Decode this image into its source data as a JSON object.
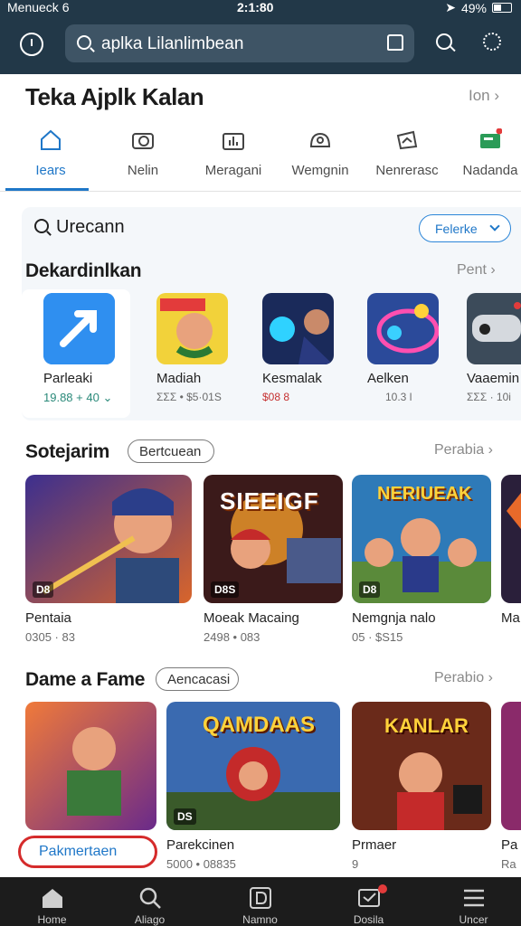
{
  "status_bar": {
    "carrier": "Menueck 6",
    "time": "2:1:80",
    "battery": "49%",
    "battery_level": 0.49
  },
  "header": {
    "search_query": "aplka Lilanlimbean"
  },
  "title_section": {
    "title": "Teka Ajplk Kalan",
    "more": "Ion"
  },
  "tabs": [
    {
      "label": "Iears",
      "icon": "home-icon",
      "active": true
    },
    {
      "label": "Nelin",
      "icon": "camera-icon",
      "active": false
    },
    {
      "label": "Meragani",
      "icon": "chart-icon",
      "active": false
    },
    {
      "label": "Wemgnin",
      "icon": "face-icon",
      "active": false
    },
    {
      "label": "Nenrerasc",
      "icon": "ticket-icon",
      "active": false
    },
    {
      "label": "Nadanda",
      "icon": "wallet-icon",
      "active": false
    }
  ],
  "card": {
    "search_text": "Urecann",
    "pill_label": "Felerke",
    "section_title": "Dekardinlkan",
    "section_more": "Pent"
  },
  "apps": [
    {
      "name": "Parleaki",
      "meta": "19.88 + 40"
    },
    {
      "name": "Madiah",
      "meta": "ΣΣΣ • $5·01S"
    },
    {
      "name": "Kesmalak",
      "meta": "$08 8"
    },
    {
      "name": "Aelken",
      "meta": "10.3 l"
    },
    {
      "name": "Vaaemin",
      "meta": "ΣΣΣ · 10i"
    }
  ],
  "section2": {
    "title": "Sotejarim",
    "pill": "Bertcuean",
    "more": "Perabia",
    "games": [
      {
        "name": "Pentaia",
        "meta": "0305 · 83",
        "badge": "D8"
      },
      {
        "name": "Moeak Macaing",
        "meta": "2498 • 083",
        "badge": "D8S",
        "art_text": "SIEEIGF"
      },
      {
        "name": "Nemgnja nalo",
        "meta": "05 · $S15",
        "badge": "D8",
        "art_text": "NERIUEAK"
      },
      {
        "name": "Ma",
        "meta": "",
        "badge": ""
      }
    ]
  },
  "section3": {
    "title": "Dame a Fame",
    "pill": "Aencacasi",
    "more": "Perabio",
    "games": [
      {
        "name": "",
        "meta": "",
        "badge": ""
      },
      {
        "name": "Parekcinen",
        "meta": "5000 • 08835",
        "badge": "DS",
        "art_text": "QAMDAAS"
      },
      {
        "name": "Prmaer",
        "meta": "9",
        "badge": "",
        "art_text": "KANLAR"
      },
      {
        "name": "Pa",
        "meta": "Ra",
        "badge": ""
      }
    ],
    "cta": "Pakmertaen"
  },
  "bottom_nav": [
    {
      "label": "Home",
      "icon": "home-icon"
    },
    {
      "label": "Aliago",
      "icon": "search-icon"
    },
    {
      "label": "Namno",
      "icon": "library-icon"
    },
    {
      "label": "Dosila",
      "icon": "inbox-icon",
      "notification": true
    },
    {
      "label": "Uncer",
      "icon": "menu-icon"
    }
  ],
  "colors": {
    "header_bg": "#223848",
    "accent": "#1f77c8",
    "cta_border": "#d52b2b",
    "nav_bg": "#1c1c1c"
  }
}
